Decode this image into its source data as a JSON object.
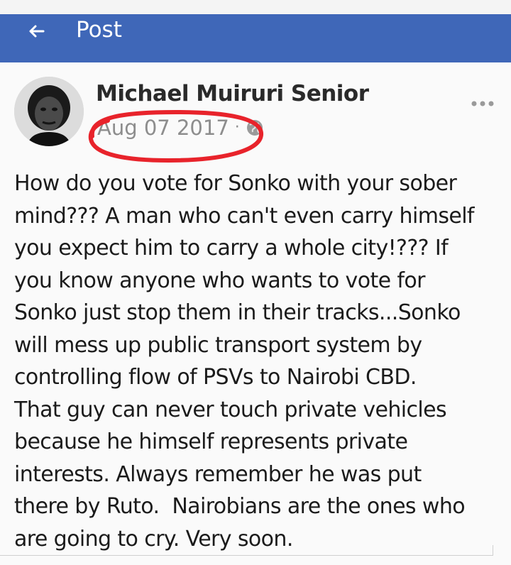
{
  "header": {
    "title": "Post",
    "back_icon": "arrow-left-icon",
    "background_color": "#3f67b8"
  },
  "post": {
    "author": "Michael Muiruri Senior",
    "date": "Aug 07 2017",
    "separator": "·",
    "privacy_icon": "globe-icon",
    "more_icon": "ellipsis-icon",
    "highlight_color": "#e8232b",
    "text": "How do you vote for Sonko with your sober\nmind??? A man who can't even carry himself\nyou expect him to carry a whole city!??? If\nyou know anyone who wants to vote for\nSonko just stop them in their tracks...Sonko\nwill mess up public transport system by\ncontrolling flow of PSVs to Nairobi CBD.\nThat guy can never touch private vehicles\nbecause he himself represents private\ninterests. Always remember he was put\nthere by Ruto.  Nairobians are the ones who\nare going to cry. Very soon."
  }
}
